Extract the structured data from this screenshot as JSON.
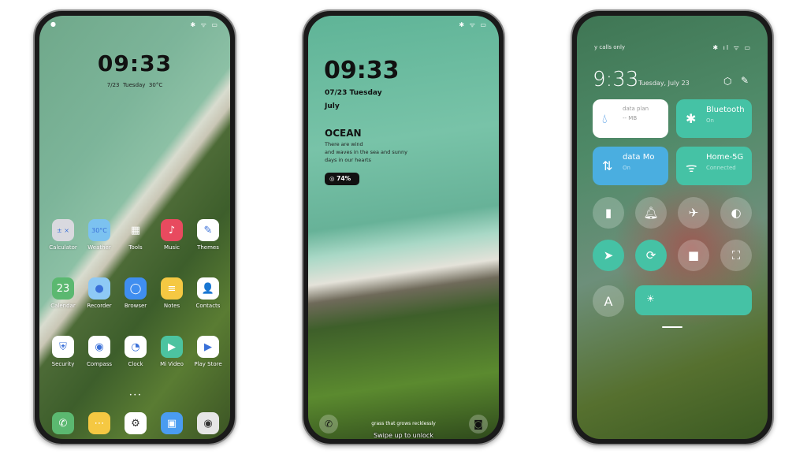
{
  "home": {
    "time": "09:33",
    "date": "7/23",
    "weekday": "Tuesday",
    "temp": "30°C",
    "apps": [
      {
        "label": "Calculator",
        "icon": "calculator-icon",
        "color": "#d9d9df",
        "glyph": "± ×"
      },
      {
        "label": "Weather",
        "icon": "weather-icon",
        "color": "#7cc2f0",
        "glyph": "30°C"
      },
      {
        "label": "Tools",
        "icon": "tools-icon",
        "color": "transparent",
        "glyph": "▦"
      },
      {
        "label": "Music",
        "icon": "music-icon",
        "color": "#e84a5f",
        "glyph": "♪"
      },
      {
        "label": "Themes",
        "icon": "themes-icon",
        "color": "#ffffff",
        "glyph": "✎"
      },
      {
        "label": "Calendar",
        "icon": "calendar-icon",
        "color": "#5bb870",
        "glyph": "23"
      },
      {
        "label": "Recorder",
        "icon": "recorder-icon",
        "color": "#8ec9f5",
        "glyph": "●"
      },
      {
        "label": "Browser",
        "icon": "browser-icon",
        "color": "#3f8ef0",
        "glyph": "◯"
      },
      {
        "label": "Notes",
        "icon": "notes-icon",
        "color": "#f5c842",
        "glyph": "≡"
      },
      {
        "label": "Contacts",
        "icon": "contacts-icon",
        "color": "#ffffff",
        "glyph": "👤"
      },
      {
        "label": "Security",
        "icon": "shield-icon",
        "color": "#ffffff",
        "glyph": "⛨"
      },
      {
        "label": "Compass",
        "icon": "compass-icon",
        "color": "#ffffff",
        "glyph": "◉"
      },
      {
        "label": "Clock",
        "icon": "clock-icon",
        "color": "#ffffff",
        "glyph": "◔"
      },
      {
        "label": "Mi Video",
        "icon": "video-icon",
        "color": "#4cc3a0",
        "glyph": "▶"
      },
      {
        "label": "Play Store",
        "icon": "play-store-icon",
        "color": "#ffffff",
        "glyph": "▶"
      }
    ],
    "dock": [
      {
        "icon": "phone-icon",
        "color": "#5bb870",
        "glyph": "✆"
      },
      {
        "icon": "messages-icon",
        "color": "#f5c842",
        "glyph": "⋯"
      },
      {
        "icon": "settings-icon",
        "color": "#ffffff",
        "glyph": "⚙"
      },
      {
        "icon": "gallery-icon",
        "color": "#4a9cf0",
        "glyph": "▣"
      },
      {
        "icon": "camera-icon",
        "color": "#e6e6e6",
        "glyph": "◉"
      }
    ]
  },
  "lock": {
    "time": "09:33",
    "date": "07/23 Tuesday",
    "month": "July",
    "title": "OCEAN",
    "poem": [
      "There are wind",
      "and waves in the sea and sunny",
      "days in our hearts"
    ],
    "battery": "74%",
    "quote": "grass that grows recklessly",
    "unlock": "Swipe up to unlock"
  },
  "control": {
    "carrier": "y calls only",
    "time": "9:33",
    "date": "Tuesday, July 23",
    "tiles": [
      {
        "title": "data plan",
        "sub": "-- MB",
        "icon": "water-drop-icon",
        "color": "#ffffff"
      },
      {
        "title": "Bluetooth",
        "sub": "On",
        "icon": "bluetooth-icon",
        "color": "#45c2a5"
      },
      {
        "title": "data      Mo",
        "sub": "On",
        "icon": "mobile-data-icon",
        "color": "#4aaee0"
      },
      {
        "title": "Home-5G",
        "sub": "Connected",
        "icon": "wifi-icon",
        "color": "#45c2a5"
      }
    ],
    "toggles": [
      {
        "icon": "flashlight-icon",
        "glyph": "▮",
        "on": false
      },
      {
        "icon": "bell-icon",
        "glyph": "🔔︎",
        "on": false
      },
      {
        "icon": "airplane-icon",
        "glyph": "✈",
        "on": false
      },
      {
        "icon": "dark-mode-icon",
        "glyph": "◐",
        "on": false
      },
      {
        "icon": "location-icon",
        "glyph": "➤",
        "on": true
      },
      {
        "icon": "rotation-lock-icon",
        "glyph": "⟳",
        "on": true
      },
      {
        "icon": "video-camera-icon",
        "glyph": "■",
        "on": false
      },
      {
        "icon": "scan-icon",
        "glyph": "⛶",
        "on": false
      }
    ],
    "auto_brightness": "A"
  },
  "accent": "#45c2a5"
}
